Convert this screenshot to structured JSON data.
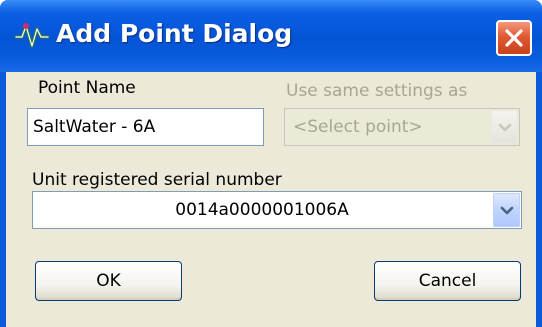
{
  "window": {
    "title": "Add Point Dialog",
    "app_icon": "signal-wave-icon",
    "close_icon": "close-icon"
  },
  "form": {
    "point_name": {
      "label": "Point Name",
      "value": "SaltWater - 6A"
    },
    "same_settings": {
      "label": "Use same settings as",
      "selected": "<Select point>",
      "enabled": false
    },
    "serial": {
      "label": "Unit registered serial number",
      "selected": "0014a0000001006A"
    }
  },
  "buttons": {
    "ok": "OK",
    "cancel": "Cancel"
  },
  "colors": {
    "titlebar": "#0553d6",
    "close": "#e15a34",
    "client": "#ece9d8",
    "field_border": "#7f9db9",
    "disabled_text": "#a7a695"
  }
}
